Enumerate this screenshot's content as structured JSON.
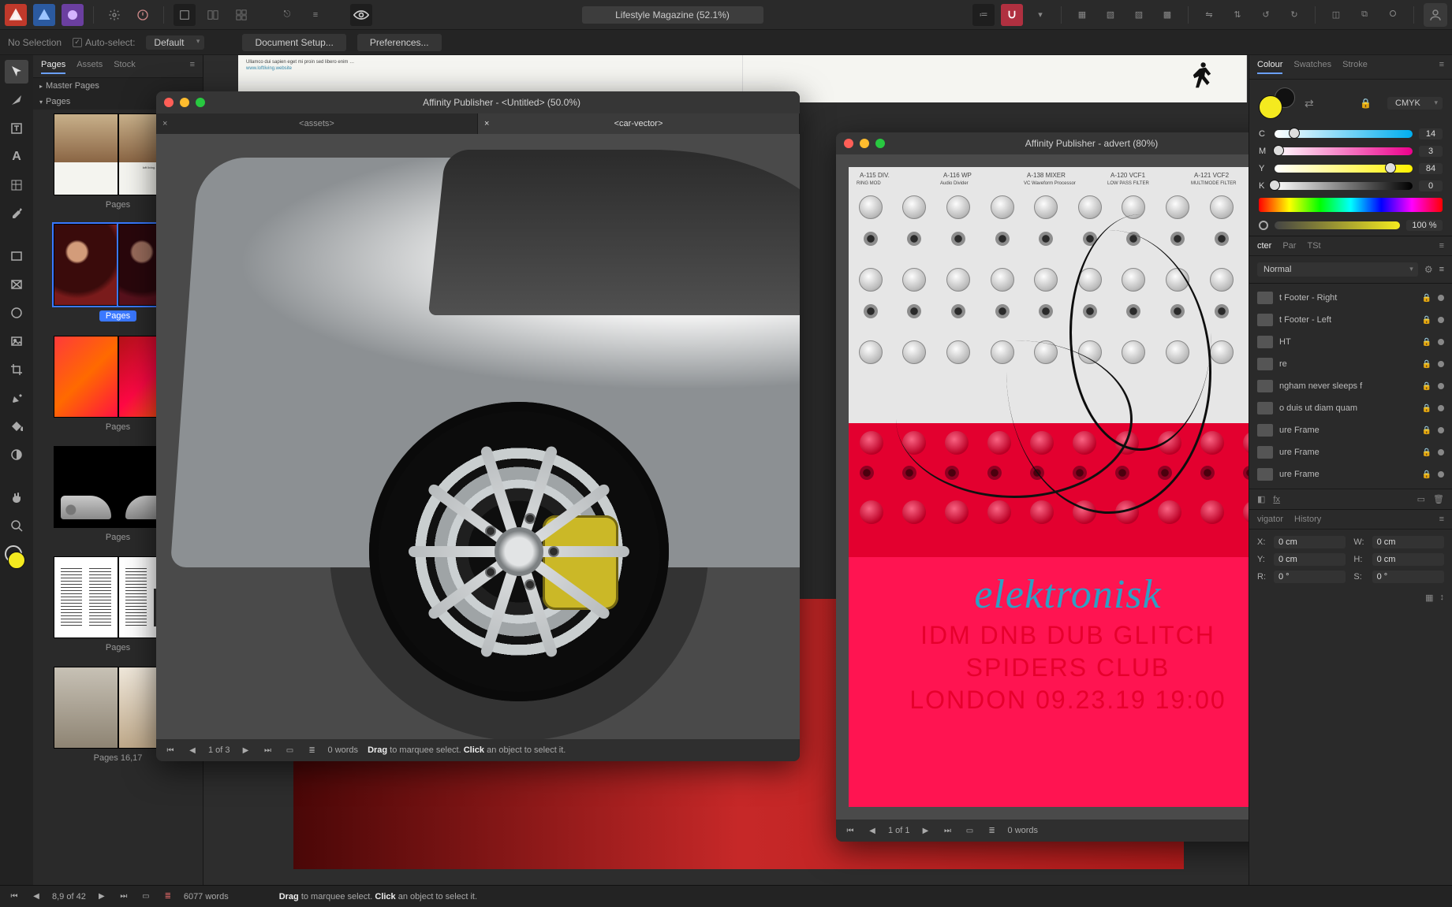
{
  "app_name": "Affinity Publisher",
  "document": {
    "title": "Lifestyle Magazine",
    "zoom": "52.1%",
    "title_pill": "Lifestyle Magazine (52.1%)"
  },
  "context_bar": {
    "selection": "No Selection",
    "auto_select_label": "Auto-select:",
    "auto_select_value": "Default",
    "document_setup": "Document Setup...",
    "preferences": "Preferences..."
  },
  "pages_panel": {
    "tabs": [
      "Pages",
      "Assets",
      "Stock"
    ],
    "active_tab": 0,
    "master_pages_header": "Master Pages",
    "pages_header": "Pages",
    "spreads": [
      {
        "caption": "Pages"
      },
      {
        "caption": "Pages"
      },
      {
        "caption": "Pages"
      },
      {
        "caption": "Pages"
      },
      {
        "caption": "Pages"
      },
      {
        "caption": "Pages 16,17"
      }
    ]
  },
  "win1": {
    "title": "Affinity Publisher - <Untitled> (50.0%)",
    "tabs": [
      {
        "label": "<assets>"
      },
      {
        "label": "<car-vector>"
      }
    ],
    "active_tab": 1,
    "status": {
      "page_of": "1 of 3",
      "words": "0 words",
      "hint_drag": "Drag",
      "hint_mid1": " to marquee select. ",
      "hint_click": "Click",
      "hint_mid2": " an object to select it."
    }
  },
  "win2": {
    "title": "Affinity Publisher - advert (80%)",
    "status": {
      "page_of": "1 of 1",
      "words": "0 words"
    },
    "advert": {
      "brand": "elektronisk",
      "line1": "IDM DNB DUB GLITCH",
      "line2": "SPIDERS CLUB",
      "line3": "LONDON 09.23.19 19:00",
      "modules": [
        "A-115 DIV.",
        "A-116 WP",
        "A-138 MIXER",
        "A-120 VCF1",
        "A-121 VCF2"
      ],
      "sublabels": [
        "RING MOD",
        "Audio Divider",
        "VC Waveform Processor",
        "LOW PASS FILTER",
        "MULTIMODE FILTER"
      ]
    }
  },
  "right": {
    "colour": {
      "tabs": [
        "Colour",
        "Swatches",
        "Stroke"
      ],
      "active_tab": 0,
      "model": "CMYK",
      "channels": [
        {
          "label": "C",
          "value": 14
        },
        {
          "label": "M",
          "value": 3
        },
        {
          "label": "Y",
          "value": 84
        },
        {
          "label": "K",
          "value": 0
        }
      ],
      "opacity_label": "Opacity",
      "opacity_value": "100 %"
    },
    "character": {
      "tabs": [
        "cter",
        "Par",
        "TSt"
      ],
      "style": "Normal"
    },
    "layers": {
      "items": [
        {
          "name": "t Footer - Right"
        },
        {
          "name": "t Footer - Left"
        },
        {
          "name": "HT"
        },
        {
          "name": "re"
        },
        {
          "name": "ngham never sleeps f"
        },
        {
          "name": "o duis ut diam quam"
        },
        {
          "name": "ure Frame"
        },
        {
          "name": "ure Frame"
        },
        {
          "name": "ure Frame"
        }
      ]
    },
    "nav_tabs": [
      "vigator",
      "History"
    ],
    "transform": {
      "x": "0 cm",
      "y": "0 cm",
      "w": "0 cm",
      "h": "0 cm",
      "r": "0 °",
      "s": "0 °"
    }
  },
  "status_main": {
    "page_of": "8,9 of 42",
    "words": "6077 words",
    "hint_drag": "Drag",
    "hint_mid1": " to marquee select. ",
    "hint_click": "Click",
    "hint_mid2": " an object to select it."
  }
}
